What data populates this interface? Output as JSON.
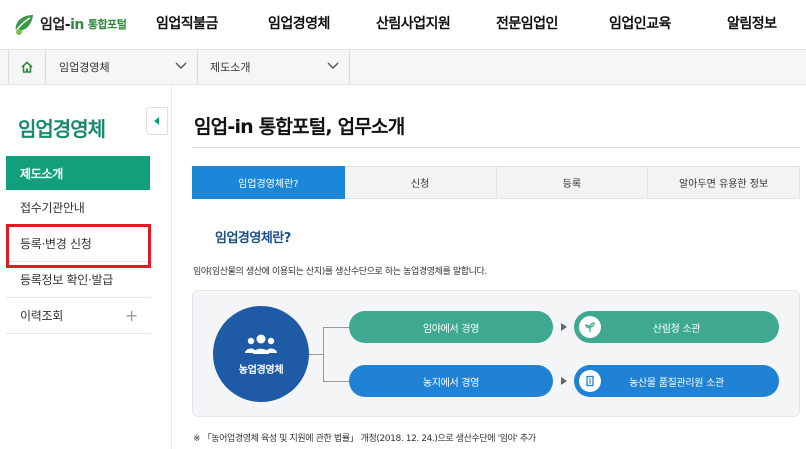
{
  "header": {
    "logo": {
      "brand": "임업-",
      "brand_accent": "in",
      "sub": "통합포털"
    },
    "nav": [
      "임업직불금",
      "임업경영체",
      "산림사업지원",
      "전문임업인",
      "임업인교육",
      "알림정보"
    ]
  },
  "breadcrumb": {
    "home_icon": "home-icon",
    "level1": "임업경영체",
    "level2": "제도소개"
  },
  "sidebar": {
    "title": "임업경영체",
    "items": [
      {
        "label": "제도소개",
        "active": true
      },
      {
        "label": "접수기관안내"
      },
      {
        "label": "등록·변경 신청",
        "highlighted": true
      },
      {
        "label": "등록정보 확인·발급"
      },
      {
        "label": "이력조회",
        "expand": "+"
      }
    ]
  },
  "content": {
    "title": "임업-in 통합포털, 업무소개",
    "tabs": [
      "임업경영체란?",
      "신청",
      "등록",
      "알아두면 유용한 정보"
    ],
    "section_title": "임업경영체란?",
    "description": "임야(임산물의 생산에 이용되는 산지)를 생산수단으로 하는 농업경영체를 말합니다.",
    "diagram": {
      "center": "농업경영체",
      "rows": [
        {
          "left": "임야에서 경영",
          "right": "산림청 소관",
          "color": "#3ea890"
        },
        {
          "left": "농지에서 경영",
          "right": "농산물 품질관리원 소관",
          "color": "#1f82d4"
        }
      ]
    },
    "note": "※ 「농어업경영체 육성 및 지원에 관한 법률」 개정(2018. 12. 24.)으로 생산수단에 '임야' 추가"
  },
  "colors": {
    "accent_green": "#11a07b",
    "accent_blue": "#1c86d9",
    "highlight": "#e21b23"
  }
}
